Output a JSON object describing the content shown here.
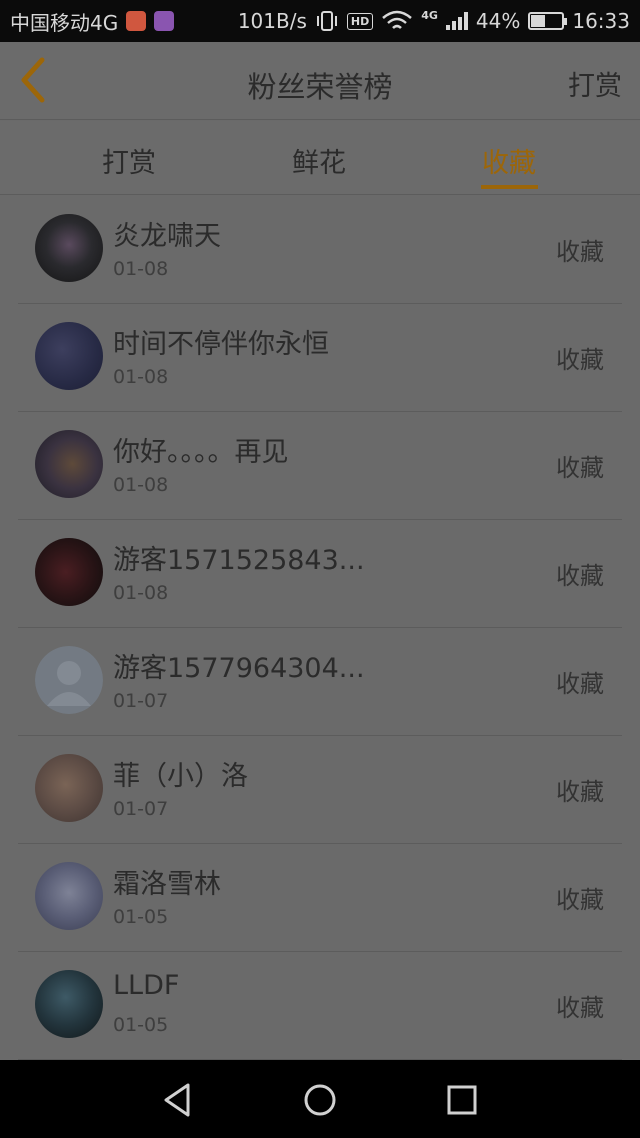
{
  "status_bar": {
    "carrier": "中国移动4G",
    "speed": "101B/s",
    "hd": "HD",
    "net": "4G",
    "battery": "44%",
    "battery_level": 0.44,
    "time": "16:33"
  },
  "header": {
    "title": "粉丝荣誉榜",
    "right_action": "打赏"
  },
  "tabs": [
    {
      "label": "打赏",
      "active": false
    },
    {
      "label": "鲜花",
      "active": false
    },
    {
      "label": "收藏",
      "active": true
    }
  ],
  "accent_color": "#9c6609",
  "rows": [
    {
      "name": "炎龙啸天",
      "date": "01-08",
      "action": "收藏"
    },
    {
      "name": "时间不停伴你永恒",
      "date": "01-08",
      "action": "收藏"
    },
    {
      "name": "你好。。。。再见",
      "date": "01-08",
      "action": "收藏"
    },
    {
      "name": "游客1571525843...",
      "date": "01-08",
      "action": "收藏"
    },
    {
      "name": "游客1577964304...",
      "date": "01-07",
      "action": "收藏"
    },
    {
      "name": "菲（小）洛",
      "date": "01-07",
      "action": "收藏"
    },
    {
      "name": "霜洛雪林",
      "date": "01-05",
      "action": "收藏"
    },
    {
      "name": "LLDF",
      "date": "01-05",
      "action": "收藏"
    }
  ],
  "nav": {
    "icons": [
      "back-triangle-icon",
      "home-circle-icon",
      "recents-square-icon"
    ]
  }
}
